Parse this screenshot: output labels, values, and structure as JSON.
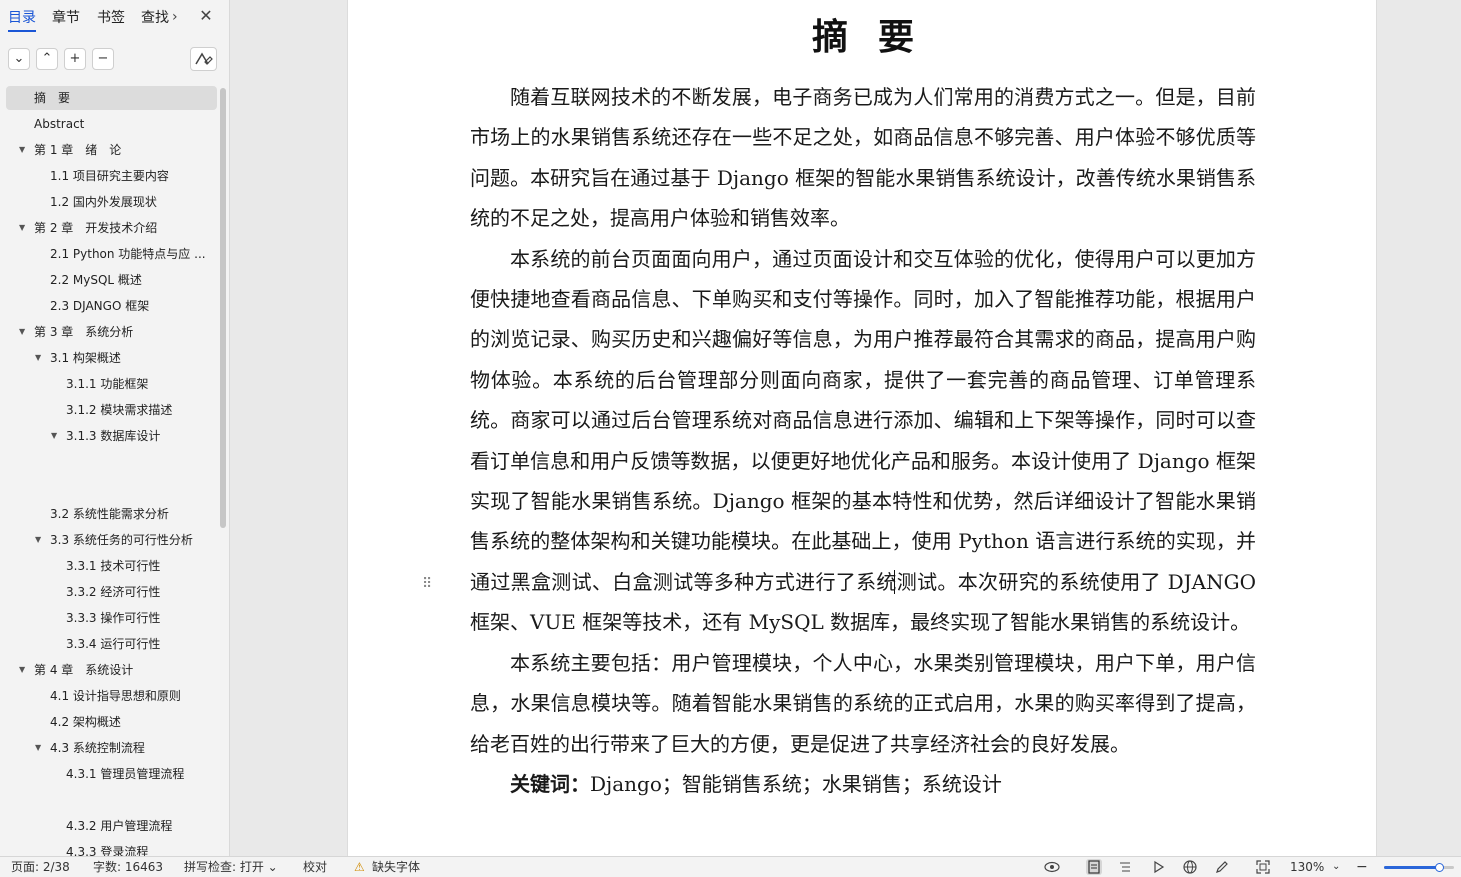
{
  "nav": {
    "tabs": [
      "目录",
      "章节",
      "书签",
      "查找"
    ],
    "more_glyph": "›",
    "close_glyph": "✕",
    "buttons": [
      "⌄",
      "⌃",
      "+",
      "−"
    ],
    "outline": [
      {
        "label": "摘　要",
        "level": 0,
        "expanded": null,
        "selected": true
      },
      {
        "label": "Abstract",
        "level": 0,
        "expanded": null
      },
      {
        "label": "第 1 章　绪　论",
        "level": 0,
        "expanded": true
      },
      {
        "label": "1.1 项目研究主要内容",
        "level": 1,
        "expanded": null
      },
      {
        "label": "1.2 国内外发展现状",
        "level": 1,
        "expanded": null
      },
      {
        "label": "第 2 章　开发技术介绍",
        "level": 0,
        "expanded": true
      },
      {
        "label": "2.1 Python 功能特点与应 ...",
        "level": 1,
        "expanded": null
      },
      {
        "label": "2.2 MySQL 概述",
        "level": 1,
        "expanded": null
      },
      {
        "label": "2.3 DJANGO 框架",
        "level": 1,
        "expanded": null
      },
      {
        "label": "第 3 章　系统分析",
        "level": 0,
        "expanded": true
      },
      {
        "label": "3.1 构架概述",
        "level": 1,
        "expanded": true
      },
      {
        "label": "3.1.1 功能框架",
        "level": 2,
        "expanded": null
      },
      {
        "label": "3.1.2 模块需求描述",
        "level": 2,
        "expanded": null
      },
      {
        "label": "3.1.3 数据库设计",
        "level": 2,
        "expanded": true
      },
      {
        "label": "",
        "level": 2,
        "expanded": null
      },
      {
        "label": "",
        "level": 2,
        "expanded": null
      },
      {
        "label": "3.2 系统性能需求分析",
        "level": 1,
        "expanded": null
      },
      {
        "label": "3.3 系统任务的可行性分析",
        "level": 1,
        "expanded": true
      },
      {
        "label": "3.3.1 技术可行性",
        "level": 2,
        "expanded": null
      },
      {
        "label": "3.3.2 经济可行性",
        "level": 2,
        "expanded": null
      },
      {
        "label": "3.3.3 操作可行性",
        "level": 2,
        "expanded": null
      },
      {
        "label": "3.3.4 运行可行性",
        "level": 2,
        "expanded": null
      },
      {
        "label": "第 4 章　系统设计",
        "level": 0,
        "expanded": true
      },
      {
        "label": "4.1 设计指导思想和原则",
        "level": 1,
        "expanded": null
      },
      {
        "label": "4.2 架构概述",
        "level": 1,
        "expanded": null
      },
      {
        "label": "4.3 系统控制流程",
        "level": 1,
        "expanded": true
      },
      {
        "label": "4.3.1 管理员管理流程",
        "level": 2,
        "expanded": null
      },
      {
        "label": "",
        "level": 2,
        "expanded": null
      },
      {
        "label": "4.3.2 用户管理流程",
        "level": 2,
        "expanded": null
      },
      {
        "label": "4.3.3 登录流程",
        "level": 2,
        "expanded": null
      }
    ]
  },
  "document": {
    "title": "摘要",
    "paragraphs": [
      "随着互联网技术的不断发展，电子商务已成为人们常用的消费方式之一。但是，目前市场上的水果销售系统还存在一些不足之处，如商品信息不够完善、用户体验不够优质等问题。本研究旨在通过基于 Django 框架的智能水果销售系统设计，改善传统水果销售系统的不足之处，提高用户体验和销售效率。",
      "本系统的前台页面面向用户，通过页面设计和交互体验的优化，使得用户可以更加方便快捷地查看商品信息、下单购买和支付等操作。同时，加入了智能推荐功能，根据用户的浏览记录、购买历史和兴趣偏好等信息，为用户推荐最符合其需求的商品，提高用户购物体验。本系统的后台管理部分则面向商家，提供了一套完善的商品管理、订单管理系统。商家可以通过后台管理系统对商品信息进行添加、编辑和上下架等操作，同时可以查看订单信息和用户反馈等数据，以便更好地优化产品和服务。本设计使用了 Django 框架　实现了智能水果销售系统。Django 框架的基本特性和优势，然后详细设计了智能水果销售系统的整体架构和关键功能模块。在此基础上，使用 Python 语言进行系统的实现，并通过黑盒测试、白盒测试等多种方式进行了系统测试。本次研究的系统使用了 DJANGO 框架、VUE 框架等技术，还有 MySQL 数据库，最终实现了智能水果销售的系统设计。",
      "本系统主要包括：用户管理模块，个人中心，水果类别管理模块，用户下单，用户信息，水果信息模块等。随着智能水果销售的系统的正式启用，水果的购买率得到了提高，给老百姓的出行带来了巨大的方便，更是促进了共享经济社会的良好发展。"
    ],
    "keywords_label": "关键词：",
    "keywords": "Django；智能销售系统；水果销售；系统设计"
  },
  "status": {
    "page": "页面: 2/38",
    "words": "字数: 16463",
    "spell": "拼写检查: 打开 ⌄",
    "proof": "校对",
    "missing_font": "缺失字体",
    "zoom": "130%",
    "zoom_level": 0.78
  }
}
